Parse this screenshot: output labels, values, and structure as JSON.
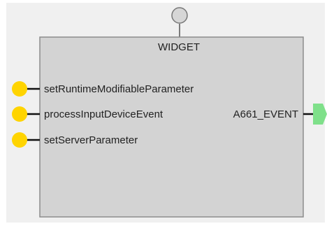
{
  "component": {
    "title": "WIDGET",
    "inputs": [
      {
        "label": "setRuntimeModifiableParameter"
      },
      {
        "label": "processInputDeviceEvent"
      },
      {
        "label": "setServerParameter"
      }
    ],
    "outputs": [
      {
        "label": "A661_EVENT"
      }
    ]
  },
  "colors": {
    "panel_bg": "#f0f0f0",
    "box_fill": "#d3d3d3",
    "box_stroke": "#8c8c8c",
    "input_port": "#ffd400",
    "output_port": "#7fe08a",
    "top_port": "#d6d6d6",
    "wire": "#111111"
  }
}
